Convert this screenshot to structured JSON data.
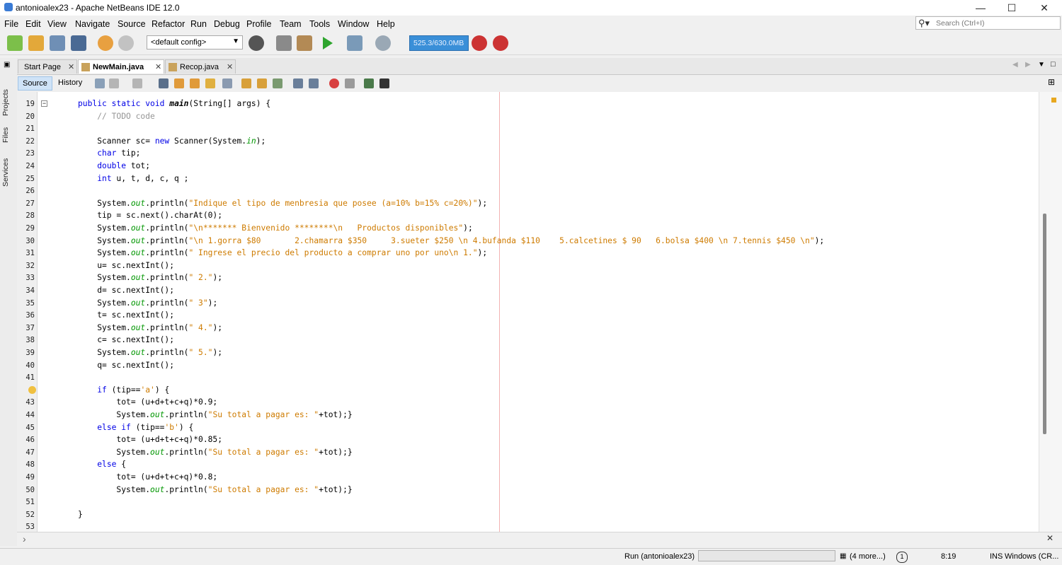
{
  "window": {
    "title": "antonioalex23 - Apache NetBeans IDE 12.0",
    "minimize": "—",
    "maximize": "☐",
    "close": "✕"
  },
  "menu": [
    "File",
    "Edit",
    "View",
    "Navigate",
    "Source",
    "Refactor",
    "Run",
    "Debug",
    "Profile",
    "Team",
    "Tools",
    "Window",
    "Help"
  ],
  "search": {
    "placeholder": "Search (Ctrl+I)",
    "icon": "search-icon"
  },
  "toolbar": {
    "config": "<default config>",
    "memory": "525.3/630.0MB"
  },
  "side_panels": [
    "Projects",
    "Files",
    "Services"
  ],
  "tabs": [
    {
      "label": "Start Page",
      "active": false
    },
    {
      "label": "NewMain.java",
      "active": true
    },
    {
      "label": "Recop.java",
      "active": false
    }
  ],
  "editor_toolbar": {
    "source": "Source",
    "history": "History"
  },
  "code": [
    {
      "ln": "19",
      "text": "    public static void main(String[] args) {"
    },
    {
      "ln": "20",
      "text": "        // TODO code"
    },
    {
      "ln": "21",
      "text": ""
    },
    {
      "ln": "22",
      "text": "        Scanner sc= new Scanner(System.in);"
    },
    {
      "ln": "23",
      "text": "        char tip;"
    },
    {
      "ln": "24",
      "text": "        double tot;"
    },
    {
      "ln": "25",
      "text": "        int u, t, d, c, q ;"
    },
    {
      "ln": "26",
      "text": ""
    },
    {
      "ln": "27",
      "text": "        System.out.println(\"Indique el tipo de menbresia que posee (a=10% b=15% c=20%)\");"
    },
    {
      "ln": "28",
      "text": "        tip = sc.next().charAt(0);"
    },
    {
      "ln": "29",
      "text": "        System.out.println(\"\\n******* Bienvenido ********\\n   Productos disponibles\");"
    },
    {
      "ln": "30",
      "text": "        System.out.println(\"\\n 1.gorra $80       2.chamarra $350     3.sueter $250 \\n 4.bufanda $110    5.calcetines $ 90   6.bolsa $400 \\n 7.tennis $450 \\n\");"
    },
    {
      "ln": "31",
      "text": "        System.out.println(\" Ingrese el precio del producto a comprar uno por uno\\n 1.\");"
    },
    {
      "ln": "32",
      "text": "        u= sc.nextInt();"
    },
    {
      "ln": "33",
      "text": "        System.out.println(\" 2.\");"
    },
    {
      "ln": "34",
      "text": "        d= sc.nextInt();"
    },
    {
      "ln": "35",
      "text": "        System.out.println(\" 3\");"
    },
    {
      "ln": "36",
      "text": "        t= sc.nextInt();"
    },
    {
      "ln": "37",
      "text": "        System.out.println(\" 4.\");"
    },
    {
      "ln": "38",
      "text": "        c= sc.nextInt();"
    },
    {
      "ln": "39",
      "text": "        System.out.println(\" 5.\");"
    },
    {
      "ln": "40",
      "text": "        q= sc.nextInt();"
    },
    {
      "ln": "41",
      "text": ""
    },
    {
      "ln": "",
      "text": "        if (tip=='a') {"
    },
    {
      "ln": "43",
      "text": "            tot= (u+d+t+c+q)*0.9;"
    },
    {
      "ln": "44",
      "text": "            System.out.println(\"Su total a pagar es: \"+tot);}"
    },
    {
      "ln": "45",
      "text": "        else if (tip=='b') {"
    },
    {
      "ln": "46",
      "text": "            tot= (u+d+t+c+q)*0.85;"
    },
    {
      "ln": "47",
      "text": "            System.out.println(\"Su total a pagar es: \"+tot);}"
    },
    {
      "ln": "48",
      "text": "        else {"
    },
    {
      "ln": "49",
      "text": "            tot= (u+d+t+c+q)*0.8;"
    },
    {
      "ln": "50",
      "text": "            System.out.println(\"Su total a pagar es: \"+tot);}"
    },
    {
      "ln": "51",
      "text": ""
    },
    {
      "ln": "52",
      "text": "}"
    },
    {
      "ln": "53",
      "text": ""
    }
  ],
  "status": {
    "run": "Run (antonioalex23)",
    "more": "(4 more...)",
    "position": "8:19",
    "mode": "INS",
    "line_ending": "Windows (CR..."
  },
  "colors": {
    "keyword": "#0000e6",
    "string": "#ce7b00",
    "comment": "#969696",
    "field": "#009600",
    "memory_bar": "#3a8fd8"
  }
}
